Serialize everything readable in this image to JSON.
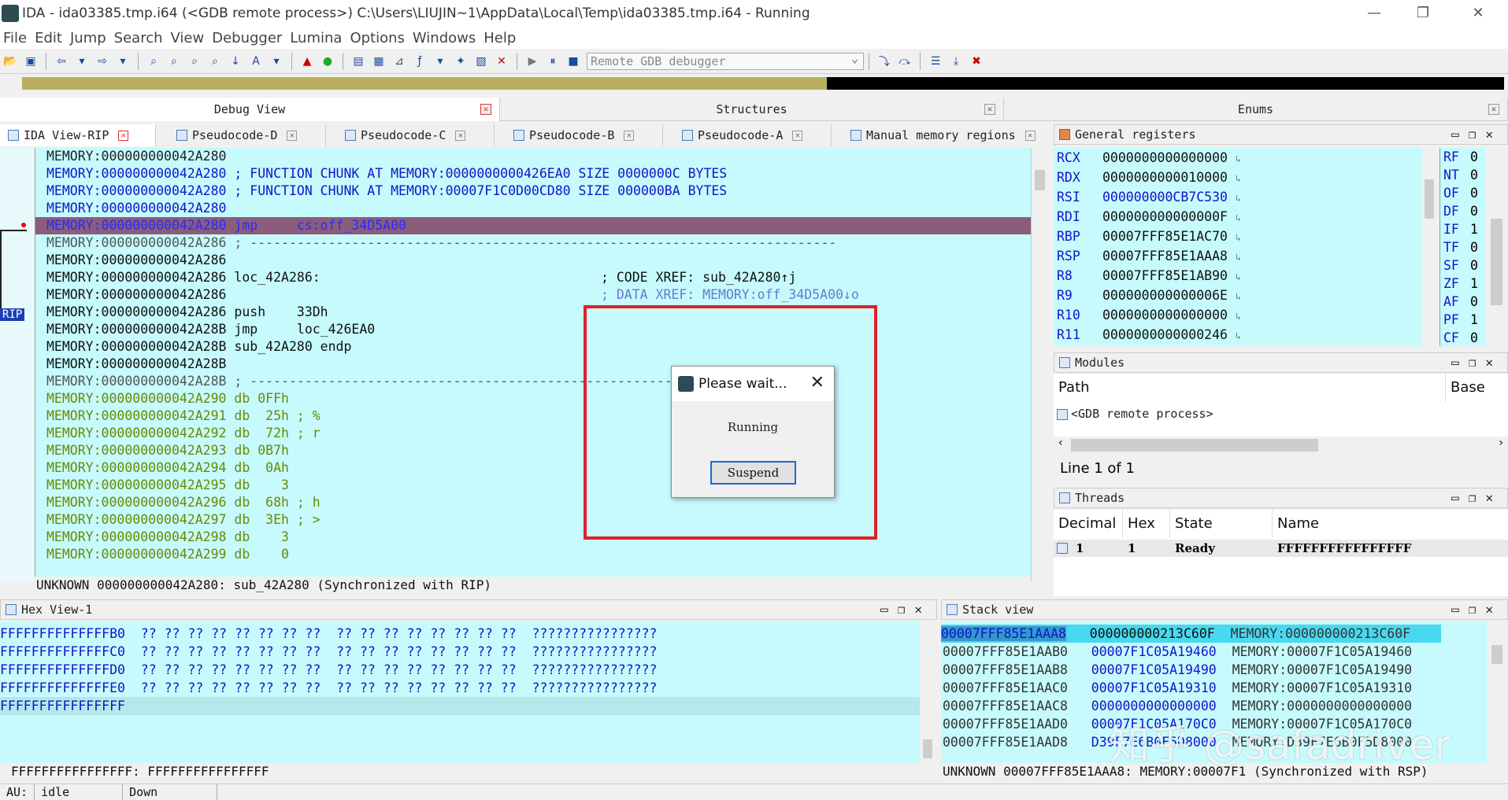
{
  "window": {
    "title": "IDA - ida03385.tmp.i64 (<GDB remote process>) C:\\Users\\LIUJIN~1\\AppData\\Local\\Temp\\ida03385.tmp.i64 - Running",
    "minimize": "—",
    "maximize": "❐",
    "close": "✕"
  },
  "menu": [
    "File",
    "Edit",
    "Jump",
    "Search",
    "View",
    "Debugger",
    "Lumina",
    "Options",
    "Windows",
    "Help"
  ],
  "toolbar": {
    "debugger": "Remote GDB debugger"
  },
  "top_tabs": {
    "debug_view": "Debug View",
    "structures": "Structures",
    "enums": "Enums"
  },
  "view_tabs": [
    "IDA View-RIP",
    "Pseudocode-D",
    "Pseudocode-C",
    "Pseudocode-B",
    "Pseudocode-A",
    "Manual memory regions"
  ],
  "gutter_label": "RIP",
  "asm": [
    "MEMORY:000000000042A280",
    "MEMORY:000000000042A280 ; FUNCTION CHUNK AT MEMORY:0000000000426EA0 SIZE 0000000C BYTES",
    "MEMORY:000000000042A280 ; FUNCTION CHUNK AT MEMORY:00007F1C0D00CD80 SIZE 000000BA BYTES",
    "MEMORY:000000000042A280",
    "MEMORY:000000000042A280 jmp     cs:off_34D5A00",
    "MEMORY:000000000042A286 ; ---------------------------------------------------------------------------",
    "MEMORY:000000000042A286",
    "MEMORY:000000000042A286 loc_42A286:",
    "MEMORY:000000000042A286",
    "MEMORY:000000000042A286 push    33Dh",
    "MEMORY:000000000042A28B jmp     loc_426EA0",
    "MEMORY:000000000042A28B sub_42A280 endp",
    "MEMORY:000000000042A28B",
    "MEMORY:000000000042A28B ; ---------------------------------------------------------------------------",
    "MEMORY:000000000042A290 db 0FFh",
    "MEMORY:000000000042A291 db  25h ; %",
    "MEMORY:000000000042A292 db  72h ; r",
    "MEMORY:000000000042A293 db 0B7h",
    "MEMORY:000000000042A294 db  0Ah",
    "MEMORY:000000000042A295 db    3",
    "MEMORY:000000000042A296 db  68h ; h",
    "MEMORY:000000000042A297 db  3Eh ; >",
    "MEMORY:000000000042A298 db    3",
    "MEMORY:000000000042A299 db    0"
  ],
  "asm_comments": {
    "code_xref": "; CODE XREF: sub_42A280↑j",
    "data_xref": "; DATA XREF: MEMORY:off_34D5A00↓o"
  },
  "asm_status": "UNKNOWN 000000000042A280: sub_42A280 (Synchronized with RIP)",
  "dialog": {
    "title": "Please wait...",
    "message": "Running",
    "button": "Suspend",
    "close": "✕"
  },
  "registers": {
    "title": "General registers",
    "rows": [
      {
        "name": "RCX",
        "value": "0000000000000000"
      },
      {
        "name": "RDX",
        "value": "0000000000010000"
      },
      {
        "name": "RSI",
        "value": "000000000CB7C530"
      },
      {
        "name": "RDI",
        "value": "000000000000000F"
      },
      {
        "name": "RBP",
        "value": "00007FFF85E1AC70"
      },
      {
        "name": "RSP",
        "value": "00007FFF85E1AAA8"
      },
      {
        "name": "R8",
        "value": "00007FFF85E1AB90"
      },
      {
        "name": "R9",
        "value": "000000000000006E"
      },
      {
        "name": "R10",
        "value": "0000000000000000"
      },
      {
        "name": "R11",
        "value": "0000000000000246"
      }
    ],
    "flags": [
      {
        "name": "RF",
        "value": "0"
      },
      {
        "name": "NT",
        "value": "0"
      },
      {
        "name": "OF",
        "value": "0"
      },
      {
        "name": "DF",
        "value": "0"
      },
      {
        "name": "IF",
        "value": "1"
      },
      {
        "name": "TF",
        "value": "0"
      },
      {
        "name": "SF",
        "value": "0"
      },
      {
        "name": "ZF",
        "value": "1"
      },
      {
        "name": "AF",
        "value": "0"
      },
      {
        "name": "PF",
        "value": "1"
      },
      {
        "name": "CF",
        "value": "0"
      }
    ]
  },
  "modules": {
    "title": "Modules",
    "col_path": "Path",
    "col_base": "Base",
    "row": "<GDB remote process>",
    "footer": "Line 1 of 1"
  },
  "threads": {
    "title": "Threads",
    "cols": [
      "Decimal",
      "Hex",
      "State",
      "Name"
    ],
    "row": [
      "1",
      "1",
      "Ready",
      "FFFFFFFFFFFFFFFF"
    ]
  },
  "hexview": {
    "title": "Hex View-1",
    "rows": [
      "FFFFFFFFFFFFFFB0  ?? ?? ?? ?? ?? ?? ?? ??  ?? ?? ?? ?? ?? ?? ?? ??  ????????????????",
      "FFFFFFFFFFFFFFC0  ?? ?? ?? ?? ?? ?? ?? ??  ?? ?? ?? ?? ?? ?? ?? ??  ????????????????",
      "FFFFFFFFFFFFFFD0  ?? ?? ?? ?? ?? ?? ?? ??  ?? ?? ?? ?? ?? ?? ?? ??  ????????????????",
      "FFFFFFFFFFFFFFE0  ?? ?? ?? ?? ?? ?? ?? ??  ?? ?? ?? ?? ?? ?? ?? ??  ????????????????",
      "FFFFFFFFFFFFFFFF"
    ],
    "status": "FFFFFFFFFFFFFFFF: FFFFFFFFFFFFFFFF"
  },
  "stack": {
    "title": "Stack view",
    "rows": [
      {
        "addr": "00007FFF85E1AAA8",
        "val": "000000000213C60F",
        "ref": "MEMORY:000000000213C60F"
      },
      {
        "addr": "00007FFF85E1AAB0",
        "val": "00007F1C05A19460",
        "ref": "MEMORY:00007F1C05A19460"
      },
      {
        "addr": "00007FFF85E1AAB8",
        "val": "00007F1C05A19490",
        "ref": "MEMORY:00007F1C05A19490"
      },
      {
        "addr": "00007FFF85E1AAC0",
        "val": "00007F1C05A19310",
        "ref": "MEMORY:00007F1C05A19310"
      },
      {
        "addr": "00007FFF85E1AAC8",
        "val": "0000000000000000",
        "ref": "MEMORY:0000000000000000"
      },
      {
        "addr": "00007FFF85E1AAD0",
        "val": "00007F1C05A170C0",
        "ref": "MEMORY:00007F1C05A170C0"
      },
      {
        "addr": "00007FFF85E1AAD8",
        "val": "D39F7E6B0F5D8000",
        "ref": "MEMORY:D39F7E6B0F5D8000"
      }
    ],
    "status": "UNKNOWN 00007FFF85E1AAA8: MEMORY:00007F1 (Synchronized with RSP)"
  },
  "statusbar": {
    "mode": "AU:",
    "state": "idle",
    "dir": "Down"
  },
  "watermark": "知乎 @safadriver",
  "colors": {
    "view_bg": "#c6fafd",
    "highlight": "#8a5e7a",
    "address": "#1414c8",
    "comment": "#2aa02a",
    "red_box": "#e0202a"
  }
}
